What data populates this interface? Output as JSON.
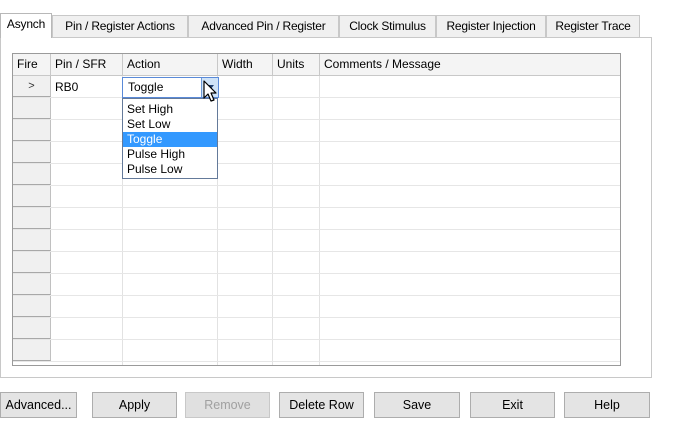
{
  "tabs": [
    {
      "label": "Asynch",
      "active": true
    },
    {
      "label": "Pin / Register Actions",
      "active": false
    },
    {
      "label": "Advanced Pin / Register",
      "active": false
    },
    {
      "label": "Clock Stimulus",
      "active": false
    },
    {
      "label": "Register Injection",
      "active": false
    },
    {
      "label": "Register Trace",
      "active": false
    }
  ],
  "grid": {
    "columns": [
      "Fire",
      "Pin / SFR",
      "Action",
      "Width",
      "Units",
      "Comments / Message"
    ],
    "rows": [
      {
        "fire": ">",
        "pin": "RB0",
        "action": "Toggle",
        "width": "",
        "units": "",
        "comment": ""
      }
    ],
    "empty_rows": 12
  },
  "action_combo": {
    "value": "Toggle",
    "options": [
      "Set High",
      "Set Low",
      "Toggle",
      "Pulse High",
      "Pulse Low"
    ],
    "selected": "Toggle"
  },
  "buttons": {
    "advanced": "Advanced...",
    "apply": "Apply",
    "remove": "Remove",
    "delete_row": "Delete Row",
    "save": "Save",
    "exit": "Exit",
    "help": "Help"
  },
  "colors": {
    "selection": "#3399ff",
    "combo_border": "#5a8ad8"
  }
}
